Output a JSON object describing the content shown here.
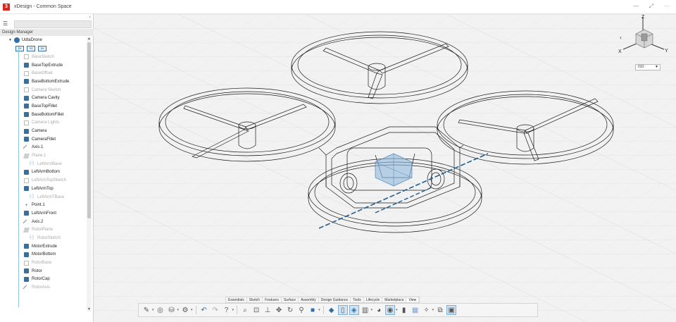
{
  "window": {
    "title": "xDesign - Common Space",
    "logo_letter": "3",
    "controls": [
      "—",
      "⤢",
      "···"
    ]
  },
  "left_panel": {
    "collapse_glyph": "‹",
    "header": "Design Manager",
    "root": {
      "label": "UdtaDrone"
    },
    "planes": [
      "XY",
      "YZ",
      "ZX"
    ],
    "items": [
      {
        "label": "BaseSketch",
        "type": "sketch",
        "dim": true
      },
      {
        "label": "BaseTopExtrude",
        "type": "solid",
        "dim": false
      },
      {
        "label": "BaseOffset",
        "type": "sketch",
        "dim": true
      },
      {
        "label": "BaseBottomExtrude",
        "type": "solid",
        "dim": false
      },
      {
        "label": "Camera Sketch",
        "type": "sketch",
        "dim": true
      },
      {
        "label": "Camera Cavity",
        "type": "solid",
        "dim": false
      },
      {
        "label": "BaseTopFillet",
        "type": "solid",
        "dim": false
      },
      {
        "label": "BaseBottomFillet",
        "type": "solid",
        "dim": false
      },
      {
        "label": "Camera Lights",
        "type": "sketch",
        "dim": true
      },
      {
        "label": "Camera",
        "type": "solid",
        "dim": false
      },
      {
        "label": "CameraFillet",
        "type": "solid",
        "dim": false
      },
      {
        "label": "Axis.1",
        "type": "axis",
        "dim": false
      },
      {
        "label": "Plane.1",
        "type": "plane",
        "dim": true
      },
      {
        "label": "LeftArmBase",
        "type": "sub",
        "dim": true
      },
      {
        "label": "LeftArmBottom",
        "type": "solid",
        "dim": false
      },
      {
        "label": "LeftArmTopSketch",
        "type": "sketch",
        "dim": true
      },
      {
        "label": "LeftArmTop",
        "type": "solid",
        "dim": false
      },
      {
        "label": "LeftArmTBase",
        "type": "sub",
        "dim": true
      },
      {
        "label": "Point.1",
        "type": "point",
        "dim": false
      },
      {
        "label": "LeftArmFront",
        "type": "solid",
        "dim": false
      },
      {
        "label": "Axis.2",
        "type": "axis",
        "dim": false
      },
      {
        "label": "RotorPlane",
        "type": "plane",
        "dim": true
      },
      {
        "label": "RotorSketch",
        "type": "sub",
        "dim": true
      },
      {
        "label": "MotorExtrude",
        "type": "solid",
        "dim": false
      },
      {
        "label": "MotorBottom",
        "type": "solid",
        "dim": false
      },
      {
        "label": "RotorBase",
        "type": "sketch",
        "dim": true
      },
      {
        "label": "Rotor",
        "type": "solid",
        "dim": false
      },
      {
        "label": "RotorCap",
        "type": "solid",
        "dim": false
      },
      {
        "label": "RotorAxis",
        "type": "axis",
        "dim": true
      }
    ]
  },
  "viewport": {
    "view_select": "ISO",
    "axes": {
      "x": "X",
      "y": "Y",
      "z": "Z"
    }
  },
  "bottom": {
    "tabs": [
      "Essentials",
      "Sketch",
      "Features",
      "Surface",
      "Assembly",
      "Design Guidance",
      "Tools",
      "Lifecycle",
      "Marketplace",
      "View"
    ],
    "active_tab": "View",
    "toolbar_icons": [
      "sketch-tool-icon",
      "orbit-icon",
      "database-icon",
      "gear-icon",
      "undo-icon",
      "redo-icon",
      "help-icon",
      "zoom-icon",
      "fit-icon",
      "pan-icon",
      "move-icon",
      "rotate-icon",
      "search-icon",
      "render-icon",
      "shaded-icon",
      "outline-icon",
      "cube-icon",
      "section-icon",
      "appearance-icon",
      "visibility-icon",
      "box-icon",
      "grid-icon",
      "settings-icon",
      "window-icon",
      "display-icon"
    ]
  },
  "colors": {
    "accent": "#2e6fa8",
    "selection": "#6fa6d6",
    "axis_dash": "#1f5f8f"
  }
}
